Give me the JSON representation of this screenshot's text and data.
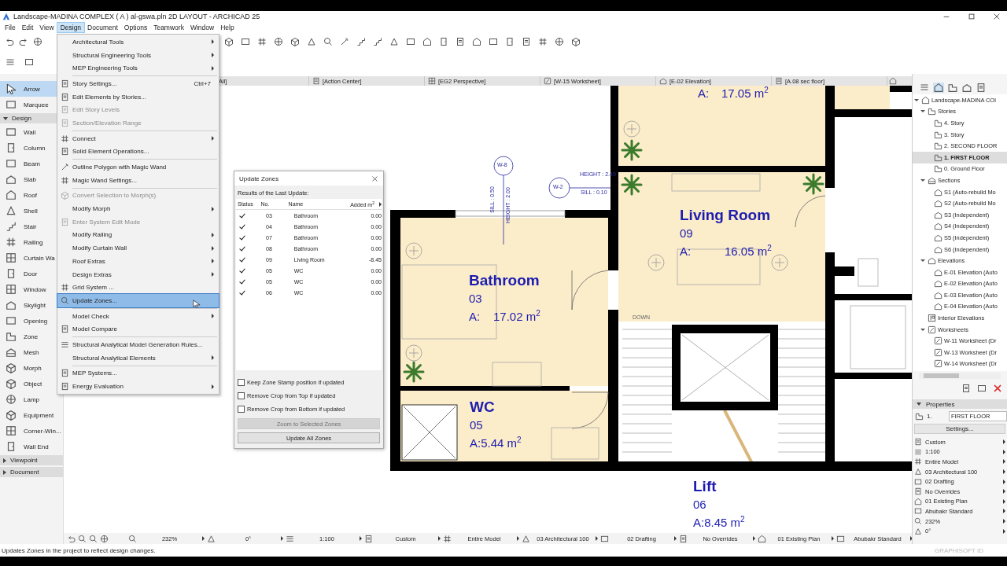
{
  "window": {
    "title": "Landscape-MADINA COMPLEX ( A ) al-gswa.pln 2D LAYOUT - ARCHICAD 25"
  },
  "menu_bar": [
    {
      "label": "File",
      "selected": false
    },
    {
      "label": "Edit",
      "selected": false
    },
    {
      "label": "View",
      "selected": false
    },
    {
      "label": "Design",
      "selected": true
    },
    {
      "label": "Document",
      "selected": false
    },
    {
      "label": "Options",
      "selected": false
    },
    {
      "label": "Teamwork",
      "selected": false
    },
    {
      "label": "Window",
      "selected": false
    },
    {
      "label": "Help",
      "selected": false
    }
  ],
  "design_menu": {
    "items": [
      {
        "kind": "item",
        "label": "Architectural Tools",
        "submenu": true,
        "disabled": false,
        "selected": false,
        "icon": false
      },
      {
        "kind": "item",
        "label": "Structural Engineering Tools",
        "submenu": true,
        "disabled": false,
        "selected": false,
        "icon": false
      },
      {
        "kind": "item",
        "label": "MEP Engineering Tools",
        "submenu": true,
        "disabled": false,
        "selected": false,
        "icon": false
      },
      {
        "kind": "separator"
      },
      {
        "kind": "item",
        "label": "Story Settings...",
        "shortcut": "Ctrl+7",
        "submenu": false,
        "disabled": false,
        "selected": false,
        "icon": true
      },
      {
        "kind": "item",
        "label": "Edit Elements by Stories...",
        "submenu": false,
        "disabled": false,
        "selected": false,
        "icon": true
      },
      {
        "kind": "item",
        "label": "Edit Story Levels",
        "submenu": false,
        "disabled": true,
        "selected": false,
        "icon": true
      },
      {
        "kind": "item",
        "label": "Section/Elevation Range",
        "submenu": false,
        "disabled": true,
        "selected": false,
        "icon": true
      },
      {
        "kind": "separator"
      },
      {
        "kind": "item",
        "label": "Connect",
        "submenu": true,
        "disabled": false,
        "selected": false,
        "icon": true
      },
      {
        "kind": "item",
        "label": "Solid Element Operations...",
        "submenu": false,
        "disabled": false,
        "selected": false,
        "icon": true
      },
      {
        "kind": "separator"
      },
      {
        "kind": "item",
        "label": "Outline Polygon with Magic Wand",
        "submenu": false,
        "disabled": false,
        "selected": false,
        "icon": true
      },
      {
        "kind": "item",
        "label": "Magic Wand Settings...",
        "submenu": false,
        "disabled": false,
        "selected": false,
        "icon": true
      },
      {
        "kind": "separator"
      },
      {
        "kind": "item",
        "label": "Convert Selection to Morph(s)",
        "submenu": false,
        "disabled": true,
        "selected": false,
        "icon": true
      },
      {
        "kind": "item",
        "label": "Modify Morph",
        "submenu": true,
        "disabled": false,
        "selected": false,
        "icon": false
      },
      {
        "kind": "item",
        "label": "Enter System Edit Mode",
        "submenu": false,
        "disabled": true,
        "selected": false,
        "icon": true
      },
      {
        "kind": "item",
        "label": "Modify Railing",
        "submenu": true,
        "disabled": false,
        "selected": false,
        "icon": false
      },
      {
        "kind": "item",
        "label": "Modify Curtain Wall",
        "submenu": true,
        "disabled": false,
        "selected": false,
        "icon": false
      },
      {
        "kind": "item",
        "label": "Roof Extras",
        "submenu": true,
        "disabled": false,
        "selected": false,
        "icon": false
      },
      {
        "kind": "item",
        "label": "Design Extras",
        "submenu": true,
        "disabled": false,
        "selected": false,
        "icon": false
      },
      {
        "kind": "item",
        "label": "Grid System ...",
        "submenu": false,
        "disabled": false,
        "selected": false,
        "icon": true
      },
      {
        "kind": "item",
        "label": "Update Zones...",
        "submenu": false,
        "disabled": false,
        "selected": true,
        "icon": true
      },
      {
        "kind": "separator"
      },
      {
        "kind": "item",
        "label": "Model Check",
        "submenu": true,
        "disabled": false,
        "selected": false,
        "icon": false
      },
      {
        "kind": "item",
        "label": "Model Compare",
        "submenu": false,
        "disabled": false,
        "selected": false,
        "icon": true
      },
      {
        "kind": "separator"
      },
      {
        "kind": "item",
        "label": "Structural Analytical Model Generation Rules...",
        "submenu": false,
        "disabled": false,
        "selected": false,
        "icon": true
      },
      {
        "kind": "item",
        "label": "Structural Analytical Elements",
        "submenu": true,
        "disabled": false,
        "selected": false,
        "icon": false
      },
      {
        "kind": "separator"
      },
      {
        "kind": "item",
        "label": "MEP Systems...",
        "submenu": false,
        "disabled": false,
        "selected": false,
        "icon": true
      },
      {
        "kind": "item",
        "label": "Energy Evaluation",
        "submenu": true,
        "disabled": false,
        "selected": false,
        "icon": true
      }
    ]
  },
  "tabs": [
    {
      "label": "All]"
    },
    {
      "label": "[Action Center]"
    },
    {
      "label": "[EG2 Perspective]"
    },
    {
      "label": "[W-15 Worksheet]"
    },
    {
      "label": "[E-02 Elevation]"
    },
    {
      "label": "[A.08 sec floor]"
    }
  ],
  "toolbox": {
    "items": [
      {
        "kind": "tool",
        "label": "Arrow",
        "selected": true
      },
      {
        "kind": "tool",
        "label": "Marquee",
        "selected": false
      },
      {
        "kind": "group",
        "label": "Design",
        "expanded": true
      },
      {
        "kind": "tool",
        "label": "Wall",
        "selected": false
      },
      {
        "kind": "tool",
        "label": "Column",
        "selected": false
      },
      {
        "kind": "tool",
        "label": "Beam",
        "selected": false
      },
      {
        "kind": "tool",
        "label": "Slab",
        "selected": false
      },
      {
        "kind": "tool",
        "label": "Roof",
        "selected": false
      },
      {
        "kind": "tool",
        "label": "Shell",
        "selected": false
      },
      {
        "kind": "tool",
        "label": "Stair",
        "selected": false
      },
      {
        "kind": "tool",
        "label": "Railing",
        "selected": false
      },
      {
        "kind": "tool",
        "label": "Curtain Wa",
        "selected": false
      },
      {
        "kind": "tool",
        "label": "Door",
        "selected": false
      },
      {
        "kind": "tool",
        "label": "Window",
        "selected": false
      },
      {
        "kind": "tool",
        "label": "Skylight",
        "selected": false
      },
      {
        "kind": "tool",
        "label": "Opening",
        "selected": false
      },
      {
        "kind": "tool",
        "label": "Zone",
        "selected": false
      },
      {
        "kind": "tool",
        "label": "Mesh",
        "selected": false
      },
      {
        "kind": "tool",
        "label": "Morph",
        "selected": false
      },
      {
        "kind": "tool",
        "label": "Object",
        "selected": false
      },
      {
        "kind": "tool",
        "label": "Lamp",
        "selected": false
      },
      {
        "kind": "tool",
        "label": "Equipment",
        "selected": false
      },
      {
        "kind": "tool",
        "label": "Corner-Win...",
        "selected": false
      },
      {
        "kind": "tool",
        "label": "Wall End",
        "selected": false
      },
      {
        "kind": "group",
        "label": "Viewpoint",
        "expanded": false
      },
      {
        "kind": "group",
        "label": "Document",
        "expanded": false
      }
    ]
  },
  "plan": {
    "partial_zone": {
      "area_label": "A:",
      "area": "17.05 m$^{2}$"
    },
    "zones": [
      {
        "name": "Living Room",
        "number": "09",
        "area_label": "A:",
        "area": "16.05 m$^{2}$"
      },
      {
        "name": "Bathroom",
        "number": "03",
        "area_label": "A:",
        "area": "17.02 m$^{2}$"
      },
      {
        "name": "WC",
        "number": "05",
        "area_label": "A:",
        "area": "5.44 m$^{2}$"
      },
      {
        "name": "Lift",
        "number": "06",
        "area_label": "A:",
        "area": "8.45 m$^{2}$"
      }
    ],
    "markers": [
      "W-8",
      "W-2"
    ],
    "annotations": [
      "HEIGHT : 2.40",
      "SILL : 0.10",
      "SILL : 0.50",
      "HEIGHT : 2.00",
      "DOWN"
    ]
  },
  "update_zones_dialog": {
    "title": "Update Zones",
    "subtitle": "Results of the Last Update:",
    "columns": [
      "Status",
      "No.",
      "Name",
      "Added m$^{2}$"
    ],
    "rows": [
      {
        "checked": true,
        "no": "03",
        "name": "Bathroom",
        "added": "0.00"
      },
      {
        "checked": true,
        "no": "04",
        "name": "Bathroom",
        "added": "0.00"
      },
      {
        "checked": true,
        "no": "07",
        "name": "Bathroom",
        "added": "0.00"
      },
      {
        "checked": true,
        "no": "08",
        "name": "Bathroom",
        "added": "0.00"
      },
      {
        "checked": true,
        "no": "09",
        "name": "Living Room",
        "added": "-8.45"
      },
      {
        "checked": true,
        "no": "05",
        "name": "WC",
        "added": "0.00"
      },
      {
        "checked": true,
        "no": "05",
        "name": "WC",
        "added": "0.00"
      },
      {
        "checked": true,
        "no": "06",
        "name": "WC",
        "added": "0.00"
      }
    ],
    "options": [
      {
        "label": "Keep Zone Stamp position if updated",
        "checked": false
      },
      {
        "label": "Remove Crop from Top if updated",
        "checked": false
      },
      {
        "label": "Remove Crop from Bottom if updated",
        "checked": false
      }
    ],
    "buttons": [
      {
        "label": "Zoom to Selected Zones",
        "disabled": true
      },
      {
        "label": "Update All Zones",
        "disabled": false
      }
    ]
  },
  "navigator": {
    "tree": [
      {
        "kind": "project",
        "label": "Landscape-MADINA COI",
        "expanded": true,
        "selected": false,
        "children": [
          {
            "kind": "folder-story",
            "label": "Stories",
            "expanded": true,
            "selected": false,
            "children": [
              {
                "kind": "story",
                "label": "4. Story",
                "selected": false
              },
              {
                "kind": "story",
                "label": "3. Story",
                "selected": false
              },
              {
                "kind": "story",
                "label": "2. SECOND FLOOR",
                "selected": false
              },
              {
                "kind": "story",
                "label": "1. FIRST FLOOR",
                "selected": true
              },
              {
                "kind": "story",
                "label": "0. Ground Floor",
                "selected": false
              }
            ]
          },
          {
            "kind": "folder-section",
            "label": "Sections",
            "expanded": true,
            "selected": false,
            "children": [
              {
                "kind": "section",
                "label": "S1 (Auto-rebuild Mo",
                "selected": false
              },
              {
                "kind": "section",
                "label": "S2 (Auto-rebuild Mo",
                "selected": false
              },
              {
                "kind": "section",
                "label": "S3 (Independent)",
                "selected": false
              },
              {
                "kind": "section",
                "label": "S4 (Independent)",
                "selected": false
              },
              {
                "kind": "section",
                "label": "S5 (Independent)",
                "selected": false
              },
              {
                "kind": "section",
                "label": "S6 (Independent)",
                "selected": false
              }
            ]
          },
          {
            "kind": "folder-elevation",
            "label": "Elevations",
            "expanded": true,
            "selected": false,
            "children": [
              {
                "kind": "elevation",
                "label": "E-01 Elevation (Auto",
                "selected": false
              },
              {
                "kind": "elevation",
                "label": "E-02 Elevation (Auto",
                "selected": false
              },
              {
                "kind": "elevation",
                "label": "E-03 Elevation (Auto",
                "selected": false
              },
              {
                "kind": "elevation",
                "label": "E-04 Elevation (Auto",
                "selected": false
              }
            ]
          },
          {
            "kind": "interior",
            "label": "Interior Elevations",
            "selected": false
          },
          {
            "kind": "folder-worksheet",
            "label": "Worksheets",
            "expanded": true,
            "selected": false,
            "children": [
              {
                "kind": "worksheet",
                "label": "W-11 Worksheet (Dr",
                "selected": false
              },
              {
                "kind": "worksheet",
                "label": "W-13 Worksheet (Dr",
                "selected": false
              },
              {
                "kind": "worksheet",
                "label": "W-14 Worksheet (Dr",
                "selected": false
              }
            ]
          }
        ]
      }
    ]
  },
  "properties": {
    "title": "Properties",
    "expanded": true,
    "story_number": "1.",
    "story_name": "FIRST FLOOR",
    "settings_button": "Settings...",
    "view_settings": [
      "Custom",
      "1:100",
      "Entire Model",
      "03 Architectural 100",
      "02 Drafting",
      "No Overrides",
      "01 Existing Plan",
      "Abubakr Standard",
      "232%",
      "0°"
    ]
  },
  "status_bar": {
    "items": [
      "232%",
      "0°",
      "1:100",
      "Custom",
      "Entire Model",
      "03 Architectural 100",
      "02 Drafting",
      "No Overrides",
      "01 Existing Plan",
      "Abubakr Standard"
    ],
    "message": "Updates Zones in the project to reflect design changes.",
    "account": "GRAPHISOFT ID"
  }
}
